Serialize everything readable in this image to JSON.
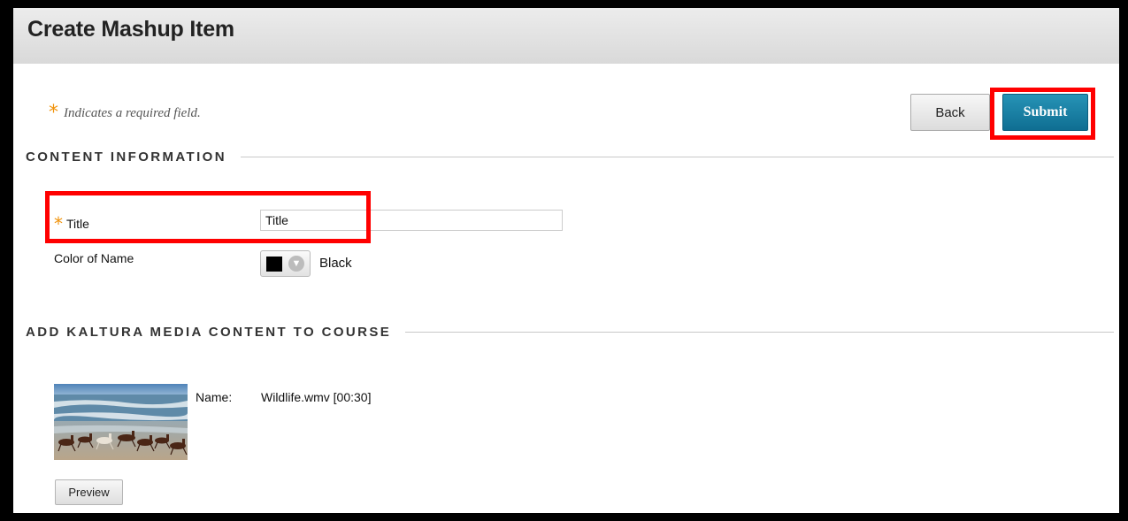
{
  "page": {
    "title": "Create Mashup Item"
  },
  "required_note": {
    "star": "*",
    "text": "Indicates a required field."
  },
  "buttons": {
    "back": "Back",
    "submit": "Submit",
    "preview": "Preview"
  },
  "sections": {
    "content_info": "CONTENT INFORMATION",
    "kaltura": "ADD KALTURA MEDIA CONTENT TO COURSE"
  },
  "form": {
    "title_label": "Title",
    "title_value": "Title",
    "color_label": "Color of Name",
    "color_value": "Black",
    "color_swatch": "#000000"
  },
  "media": {
    "name_label": "Name:",
    "name_value": "Wildlife.wmv [00:30]",
    "thumbnail_icon": "video-thumbnail-horses-beach"
  },
  "colors": {
    "accent_submit": "#1a82a6",
    "highlight": "#ff0000",
    "required": "#f0920a"
  }
}
